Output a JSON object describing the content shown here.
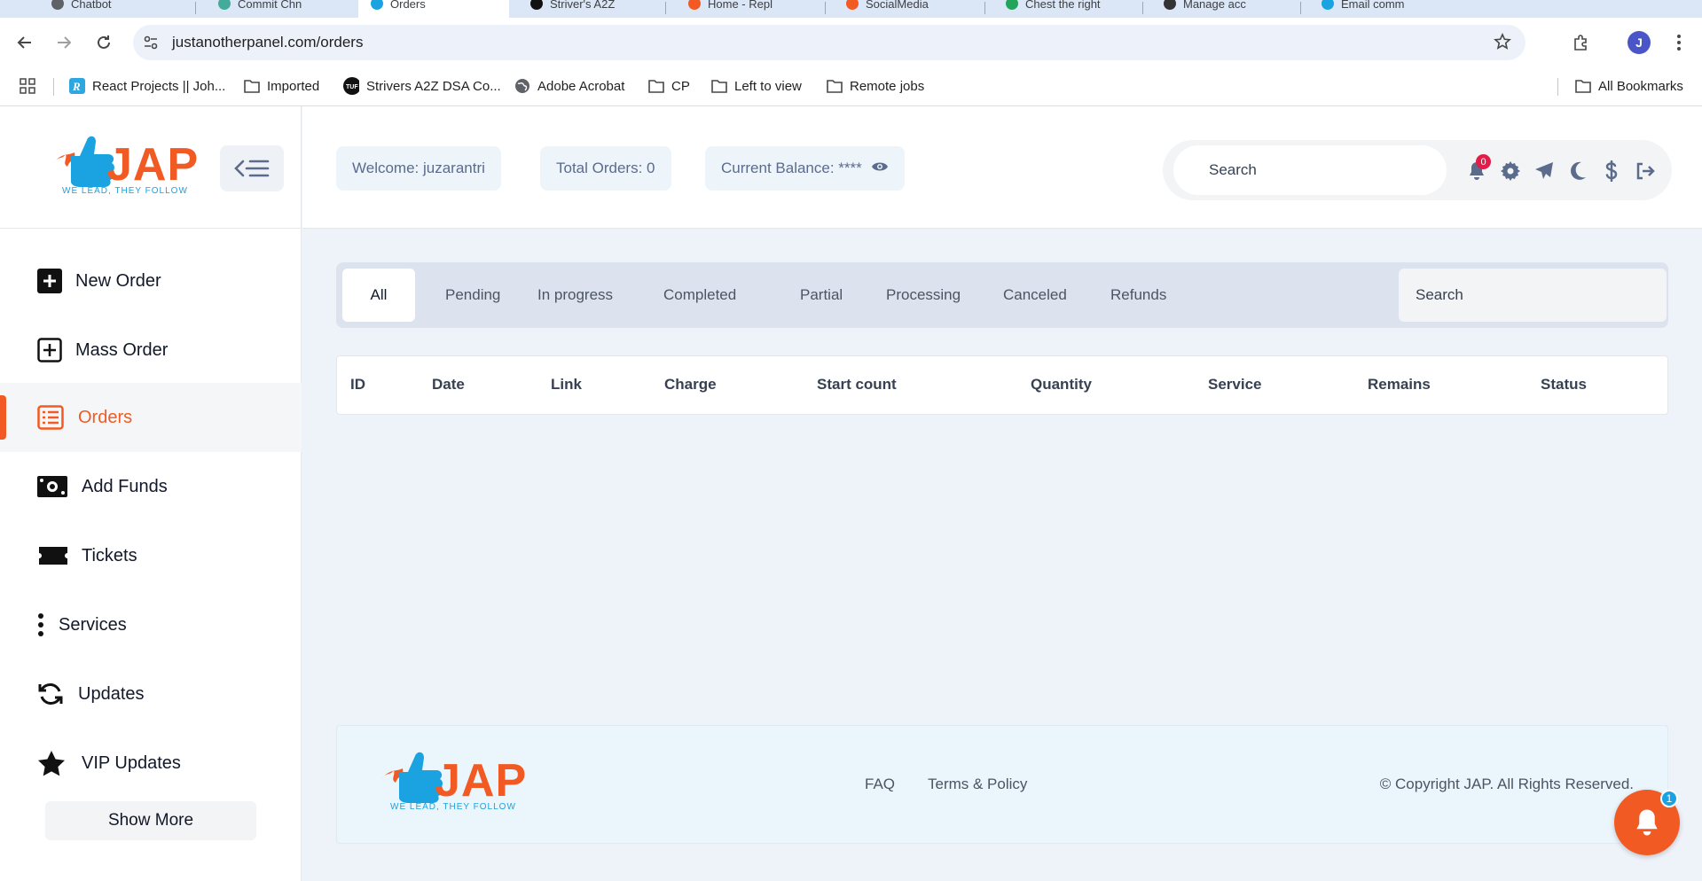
{
  "browser": {
    "tabs": [
      {
        "label": "Chatbot"
      },
      {
        "label": "Commit Chn"
      },
      {
        "label": "Orders"
      },
      {
        "label": "Striver's A2Z"
      },
      {
        "label": "Home - Repl"
      },
      {
        "label": "SocialMedia"
      },
      {
        "label": "Chest the right"
      },
      {
        "label": "Manage acc"
      },
      {
        "label": "Email comm"
      }
    ],
    "url": "justanotherpanel.com/orders",
    "profile_initial": "J",
    "bookmarks": [
      {
        "label": "React Projects || Joh...",
        "icon": "react-icon"
      },
      {
        "label": "Imported",
        "icon": "folder-icon"
      },
      {
        "label": "Strivers A2Z DSA Co...",
        "icon": "tuf-icon"
      },
      {
        "label": "Adobe Acrobat",
        "icon": "globe-icon"
      },
      {
        "label": "CP",
        "icon": "folder-icon"
      },
      {
        "label": "Left to view",
        "icon": "folder-icon"
      },
      {
        "label": "Remote jobs",
        "icon": "folder-icon"
      }
    ],
    "all_bookmarks": "All Bookmarks"
  },
  "brand": {
    "name": "JAP",
    "tagline": "WE LEAD, THEY FOLLOW",
    "primary_color": "#f15a22",
    "secondary_color": "#1aa3e0"
  },
  "sidebar": {
    "items": [
      {
        "label": "New Order",
        "icon": "plus-square-filled-icon"
      },
      {
        "label": "Mass Order",
        "icon": "plus-square-outline-icon"
      },
      {
        "label": "Orders",
        "icon": "list-icon",
        "active": true
      },
      {
        "label": "Add Funds",
        "icon": "money-icon"
      },
      {
        "label": "Tickets",
        "icon": "ticket-icon"
      },
      {
        "label": "Services",
        "icon": "ellipsis-vertical-icon"
      },
      {
        "label": "Updates",
        "icon": "refresh-icon"
      },
      {
        "label": "VIP Updates",
        "icon": "star-icon"
      }
    ],
    "show_more": "Show More"
  },
  "header": {
    "welcome": "Welcome: juzarantri",
    "total_orders": "Total Orders: 0",
    "balance": "Current Balance: ****",
    "search_placeholder": "Search",
    "notification_count": "0"
  },
  "filters": {
    "tabs": [
      "All",
      "Pending",
      "In progress",
      "Completed",
      "Partial",
      "Processing",
      "Canceled",
      "Refunds"
    ],
    "active": "All",
    "search_placeholder": "Search"
  },
  "table": {
    "columns": [
      "ID",
      "Date",
      "Link",
      "Charge",
      "Start count",
      "Quantity",
      "Service",
      "Remains",
      "Status"
    ],
    "rows": []
  },
  "footer": {
    "links": [
      "FAQ",
      "Terms & Policy"
    ],
    "copyright": "© Copyright JAP. All Rights Reserved."
  },
  "fab": {
    "count": "1"
  }
}
